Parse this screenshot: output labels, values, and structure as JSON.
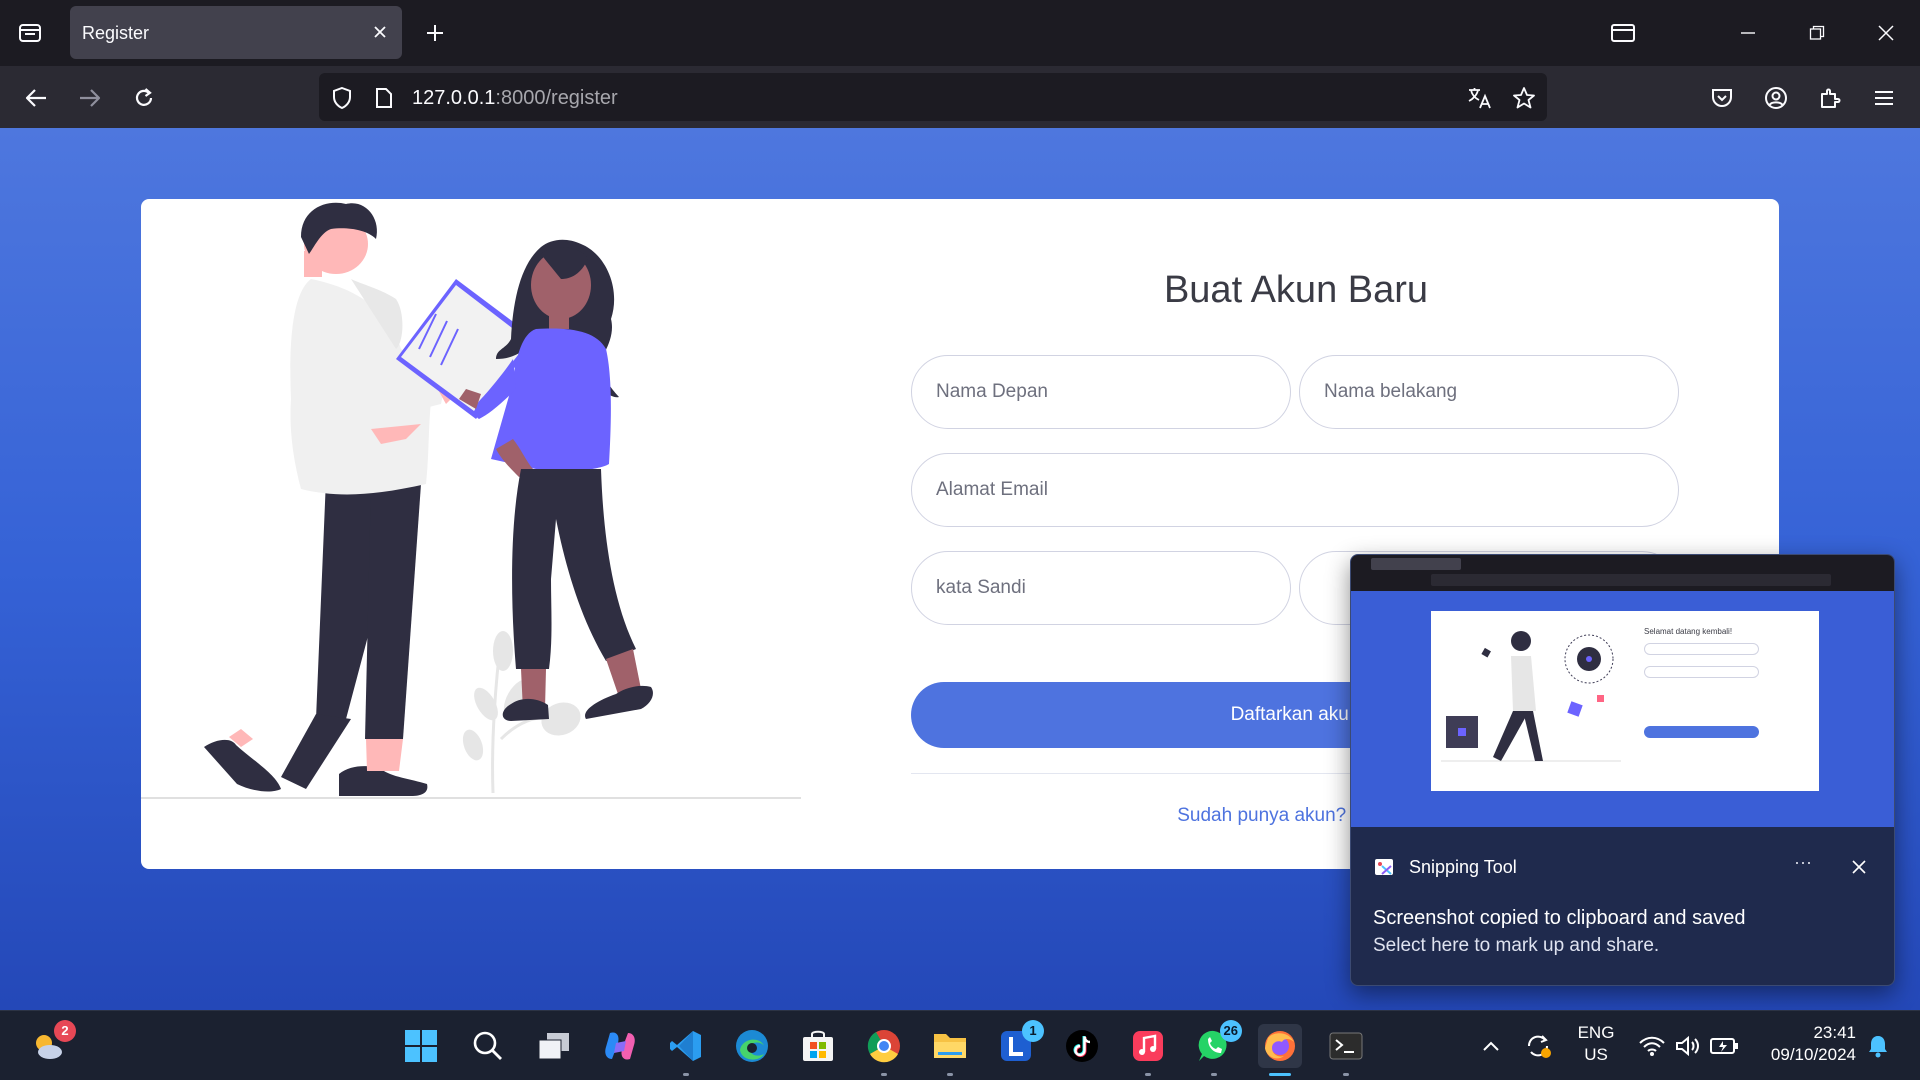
{
  "browser": {
    "tab_title": "Register",
    "url_host": "127.0.0.1",
    "url_path": ":8000/register"
  },
  "form": {
    "title": "Buat Akun Baru",
    "first_name_placeholder": "Nama Depan",
    "last_name_placeholder": "Nama belakang",
    "email_placeholder": "Alamat Email",
    "password_placeholder": "kata Sandi",
    "submit_label": "Daftarkan akun",
    "login_link": "Sudah punya akun? Masuk!"
  },
  "toast": {
    "app_name": "Snipping Tool",
    "more_label": "···",
    "line1": "Screenshot copied to clipboard and saved",
    "line2": "Select here to mark up and share.",
    "preview_title": "Selamat datang kembali!"
  },
  "taskbar": {
    "weather_badge": "2",
    "lark_badge": "1",
    "whatsapp_badge": "26",
    "lang_line1": "ENG",
    "lang_line2": "US",
    "time": "23:41",
    "date": "09/10/2024"
  },
  "colors": {
    "accent": "#4e73df",
    "page_bg_top": "#4e77de",
    "page_bg_bottom": "#2448b8",
    "illustration_purple": "#6c63ff"
  }
}
